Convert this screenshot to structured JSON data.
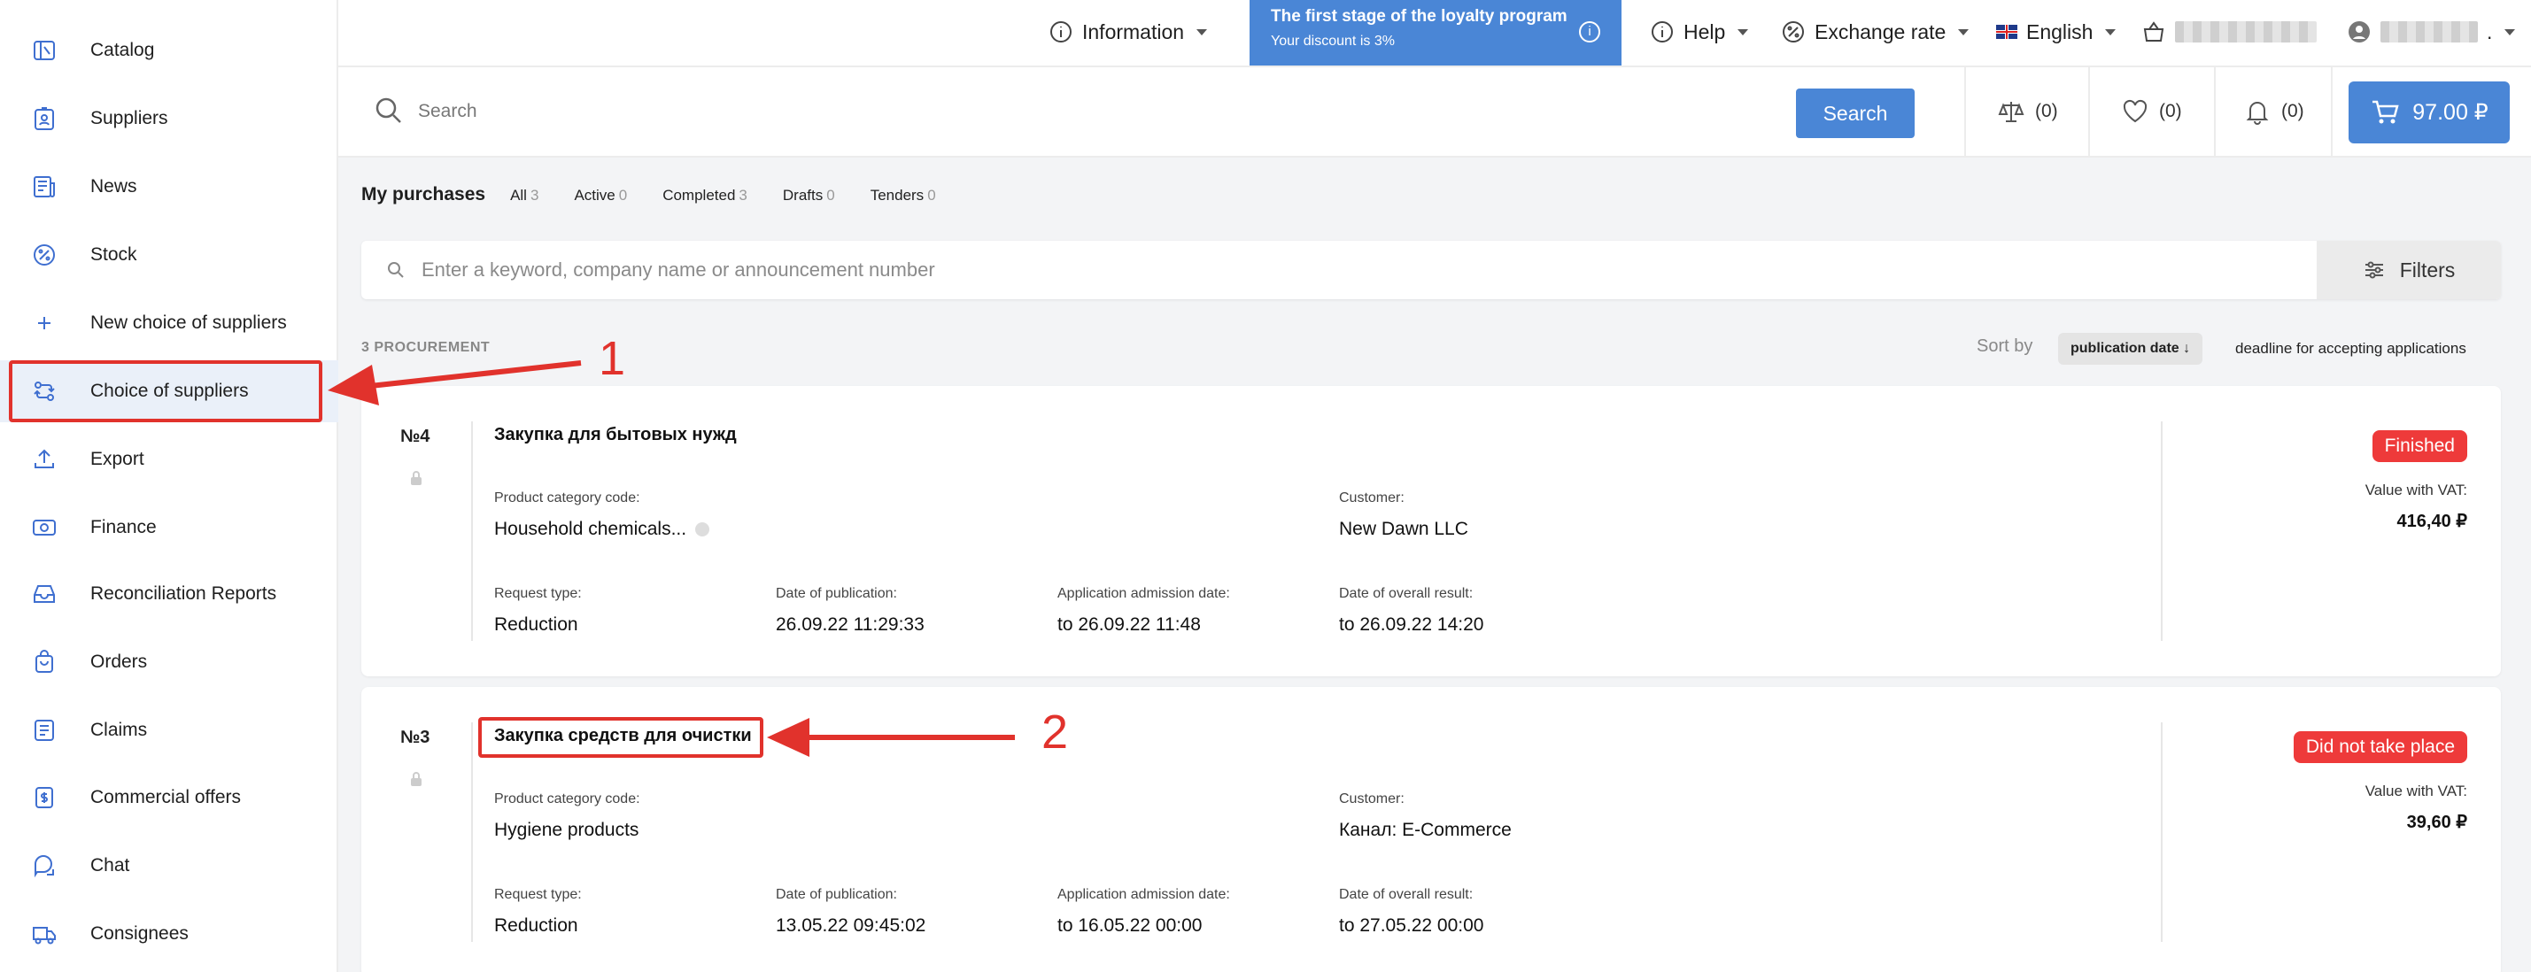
{
  "sidebar": {
    "items": [
      {
        "label": "Catalog",
        "icon": "catalog-icon"
      },
      {
        "label": "Suppliers",
        "icon": "suppliers-icon"
      },
      {
        "label": "News",
        "icon": "news-icon"
      },
      {
        "label": "Stock",
        "icon": "percent-icon"
      },
      {
        "label": "New choice of suppliers",
        "icon": "plus-icon"
      },
      {
        "label": "Choice of suppliers",
        "icon": "exchange-icon",
        "active": true
      },
      {
        "label": "Export",
        "icon": "upload-icon"
      },
      {
        "label": "Finance",
        "icon": "money-icon"
      },
      {
        "label": "Reconciliation Reports",
        "icon": "inbox-icon"
      },
      {
        "label": "Orders",
        "icon": "bag-icon"
      },
      {
        "label": "Claims",
        "icon": "claims-icon"
      },
      {
        "label": "Commercial offers",
        "icon": "offer-icon"
      },
      {
        "label": "Chat",
        "icon": "chat-icon"
      },
      {
        "label": "Consignees",
        "icon": "truck-icon"
      }
    ]
  },
  "topbar": {
    "information": "Information",
    "loyalty_title": "The first stage of the loyalty program",
    "loyalty_sub": "Your discount is 3%",
    "help": "Help",
    "exchange_rate": "Exchange rate",
    "language": "English",
    "user_suffix": "."
  },
  "search": {
    "placeholder": "Search",
    "button": "Search",
    "compare_count": "(0)",
    "favorites_count": "(0)",
    "notifications_count": "(0)",
    "cart_total": "97.00 ₽"
  },
  "purchases": {
    "title": "My purchases",
    "tabs": [
      {
        "label": "All",
        "count": "3"
      },
      {
        "label": "Active",
        "count": "0"
      },
      {
        "label": "Completed",
        "count": "3"
      },
      {
        "label": "Drafts",
        "count": "0"
      },
      {
        "label": "Tenders",
        "count": "0"
      }
    ],
    "filter_placeholder": "Enter a keyword, company name or announcement number",
    "filters_button": "Filters",
    "count_label": "3 PROCUREMENT",
    "sort_by": "Sort by",
    "sort_active": "publication date ↓",
    "sort_other": "deadline for accepting applications"
  },
  "cards": [
    {
      "number": "№4",
      "title": "Закупка для бытовых нужд",
      "category_label": "Product category code:",
      "category": "Household chemicals...",
      "customer_label": "Customer:",
      "customer": "New Dawn LLC",
      "request_type_label": "Request type:",
      "request_type": "Reduction",
      "publication_label": "Date of publication:",
      "publication": "26.09.22 11:29:33",
      "admission_label": "Application admission date:",
      "admission": "to 26.09.22 11:48",
      "result_label": "Date of overall result:",
      "result": "to 26.09.22 14:20",
      "status": "Finished",
      "vat_label": "Value with VAT:",
      "vat_value": "416,40 ₽"
    },
    {
      "number": "№3",
      "title": "Закупка средств для очистки",
      "category_label": "Product category code:",
      "category": "Hygiene products",
      "customer_label": "Customer:",
      "customer": "Канал: E-Commerce",
      "request_type_label": "Request type:",
      "request_type": "Reduction",
      "publication_label": "Date of publication:",
      "publication": "13.05.22 09:45:02",
      "admission_label": "Application admission date:",
      "admission": "to 16.05.22 00:00",
      "result_label": "Date of overall result:",
      "result": "to 27.05.22 00:00",
      "status": "Did not take place",
      "vat_label": "Value with VAT:",
      "vat_value": "39,60 ₽"
    }
  ],
  "annotations": {
    "one": "1",
    "two": "2",
    "color": "#e1322c"
  },
  "colors": {
    "accent": "#4a86d6",
    "status_red": "#ee3a3a"
  }
}
